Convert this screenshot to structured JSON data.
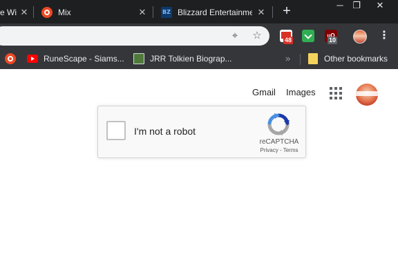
{
  "browser": {
    "tabs": [
      {
        "title": "e Wi",
        "favicon": "partial-favicon"
      },
      {
        "title": "Mix",
        "favicon": "stumbleupon-icon"
      },
      {
        "title": "Blizzard Entertainme",
        "favicon": "blizzard-icon"
      }
    ],
    "new_tab_label": "+",
    "window_controls": {
      "minimize": "─",
      "restore": "❐",
      "close": "✕"
    },
    "extensions": {
      "gmail_badge": "48",
      "ublock_badge": "10",
      "ublock_label": "uO"
    },
    "bookmarks": [
      {
        "label": "",
        "favicon": "stumbleupon-icon"
      },
      {
        "label": "RuneScape - Siams...",
        "favicon": "youtube-icon"
      },
      {
        "label": "JRR Tolkien Biograp...",
        "favicon": "book-icon"
      }
    ],
    "bookmarks_overflow": "»",
    "other_bookmarks": "Other bookmarks"
  },
  "page": {
    "gmail_link": "Gmail",
    "images_link": "Images",
    "recaptcha": {
      "label": "I'm not a robot",
      "brand": "reCAPTCHA",
      "privacy": "Privacy",
      "separator": " - ",
      "terms": "Terms"
    }
  },
  "colors": {
    "tab_strip": "#1e1f21",
    "toolbar": "#35363a",
    "omnibox": "#f1f3f4",
    "recaptcha_blue": "#1c3aa9",
    "recaptcha_gray": "#a6a6a6"
  }
}
